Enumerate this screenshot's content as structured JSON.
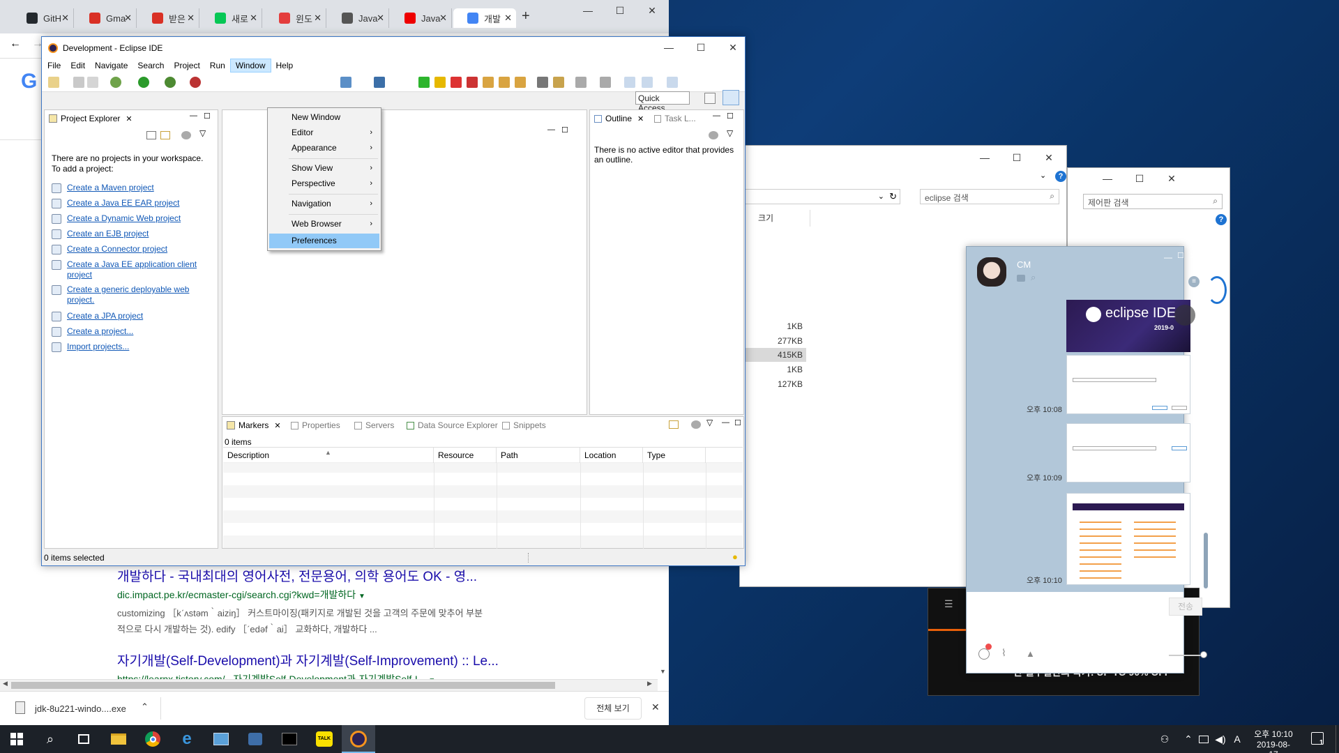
{
  "chrome": {
    "tabs": [
      {
        "label": "GitH",
        "fav": "github-icon",
        "color": "#24292e"
      },
      {
        "label": "Gma",
        "fav": "gmail-icon",
        "color": "#d93025"
      },
      {
        "label": "받은",
        "fav": "gmail-icon",
        "color": "#d93025"
      },
      {
        "label": "새로",
        "fav": "line-icon",
        "color": "#06c755"
      },
      {
        "label": "윈도",
        "fav": "z-icon",
        "color": "#e43d3d"
      },
      {
        "label": "Java",
        "fav": "globe-icon",
        "color": "#555"
      },
      {
        "label": "Java",
        "fav": "oracle-icon",
        "color": "#e00"
      },
      {
        "label": "개발",
        "fav": "google-icon",
        "color": "#4285f4"
      }
    ],
    "new_tab": "+",
    "results": [
      {
        "title": "개발하다 - 국내최대의 영어사전, 전문용어, 의학 용어도 OK - 영...",
        "url": "dic.impact.pe.kr/ecmaster-cgi/search.cgi?kwd=개발하다",
        "snippet1": "customizing ［kˊʌstəm｀aiziŋ］ 커스트마이징(패키지로 개발된 것을 고객의 주문에 맞추어 부분",
        "snippet2": "적으로 다시 개발하는 것). edify ［ˊedəf｀ai］ 교화하다, 개발하다 ..."
      },
      {
        "title": "자기개발(Self-Development)과 자기계발(Self-Improvement) :: Le...",
        "url": "https://learnx.tistory.com/...자기계발Self-Development과-자기계발Self-I..."
      }
    ],
    "download": {
      "file": "jdk-8u221-windo....exe",
      "show_all": "전체 보기"
    }
  },
  "eclipse": {
    "title": "Development - Eclipse IDE",
    "menu": [
      "File",
      "Edit",
      "Navigate",
      "Search",
      "Project",
      "Run",
      "Window",
      "Help"
    ],
    "quick_access": "Quick Access",
    "window_menu": [
      {
        "label": "New Window",
        "sub": false
      },
      {
        "label": "Editor",
        "sub": true
      },
      {
        "label": "Appearance",
        "sub": true
      },
      {
        "label": "Show View",
        "sub": true
      },
      {
        "label": "Perspective",
        "sub": true
      },
      {
        "label": "Navigation",
        "sub": true
      },
      {
        "label": "Web Browser",
        "sub": true
      },
      {
        "label": "Preferences",
        "sub": false
      }
    ],
    "explorer": {
      "tab": "Project Explorer",
      "msg1": "There are no projects in your workspace.",
      "msg2": "To add a project:",
      "links": [
        "Create a Maven project",
        "Create a Java EE EAR project",
        "Create a Dynamic Web project",
        "Create an EJB project",
        "Create a Connector project",
        "Create a Java EE application client",
        "project",
        "Create a generic deployable web",
        "project.",
        "Create a JPA project",
        "Create a project...",
        "Import projects..."
      ]
    },
    "outline": {
      "tab": "Outline",
      "tab2": "Task L...",
      "msg1": "There is no active editor that provides",
      "msg2": "an outline."
    },
    "bottom": {
      "tabs": [
        "Markers",
        "Properties",
        "Servers",
        "Data Source Explorer",
        "Snippets"
      ],
      "count": "0 items",
      "columns": [
        "Description",
        "Resource",
        "Path",
        "Location",
        "Type"
      ]
    },
    "status": "0 items selected"
  },
  "explorer_win": {
    "search": "eclipse 검색",
    "col": "크기",
    "sizes": [
      "1KB",
      "277KB",
      "415KB",
      "1KB",
      "127KB"
    ]
  },
  "control_panel": {
    "search": "제어판 검색"
  },
  "kakao": {
    "name": "CM",
    "banner": "eclipse IDE",
    "banner_ver": "2019-0",
    "times": [
      "오후 10:08",
      "오후 10:09",
      "오후 10:10"
    ],
    "send": "전송",
    "ad": "단 일주일간의 특가! UP TO 90% OFF"
  },
  "taskbar": {
    "time": "오후 10:10",
    "date": "2019-08-17",
    "lang": "A",
    "notif": "1"
  }
}
